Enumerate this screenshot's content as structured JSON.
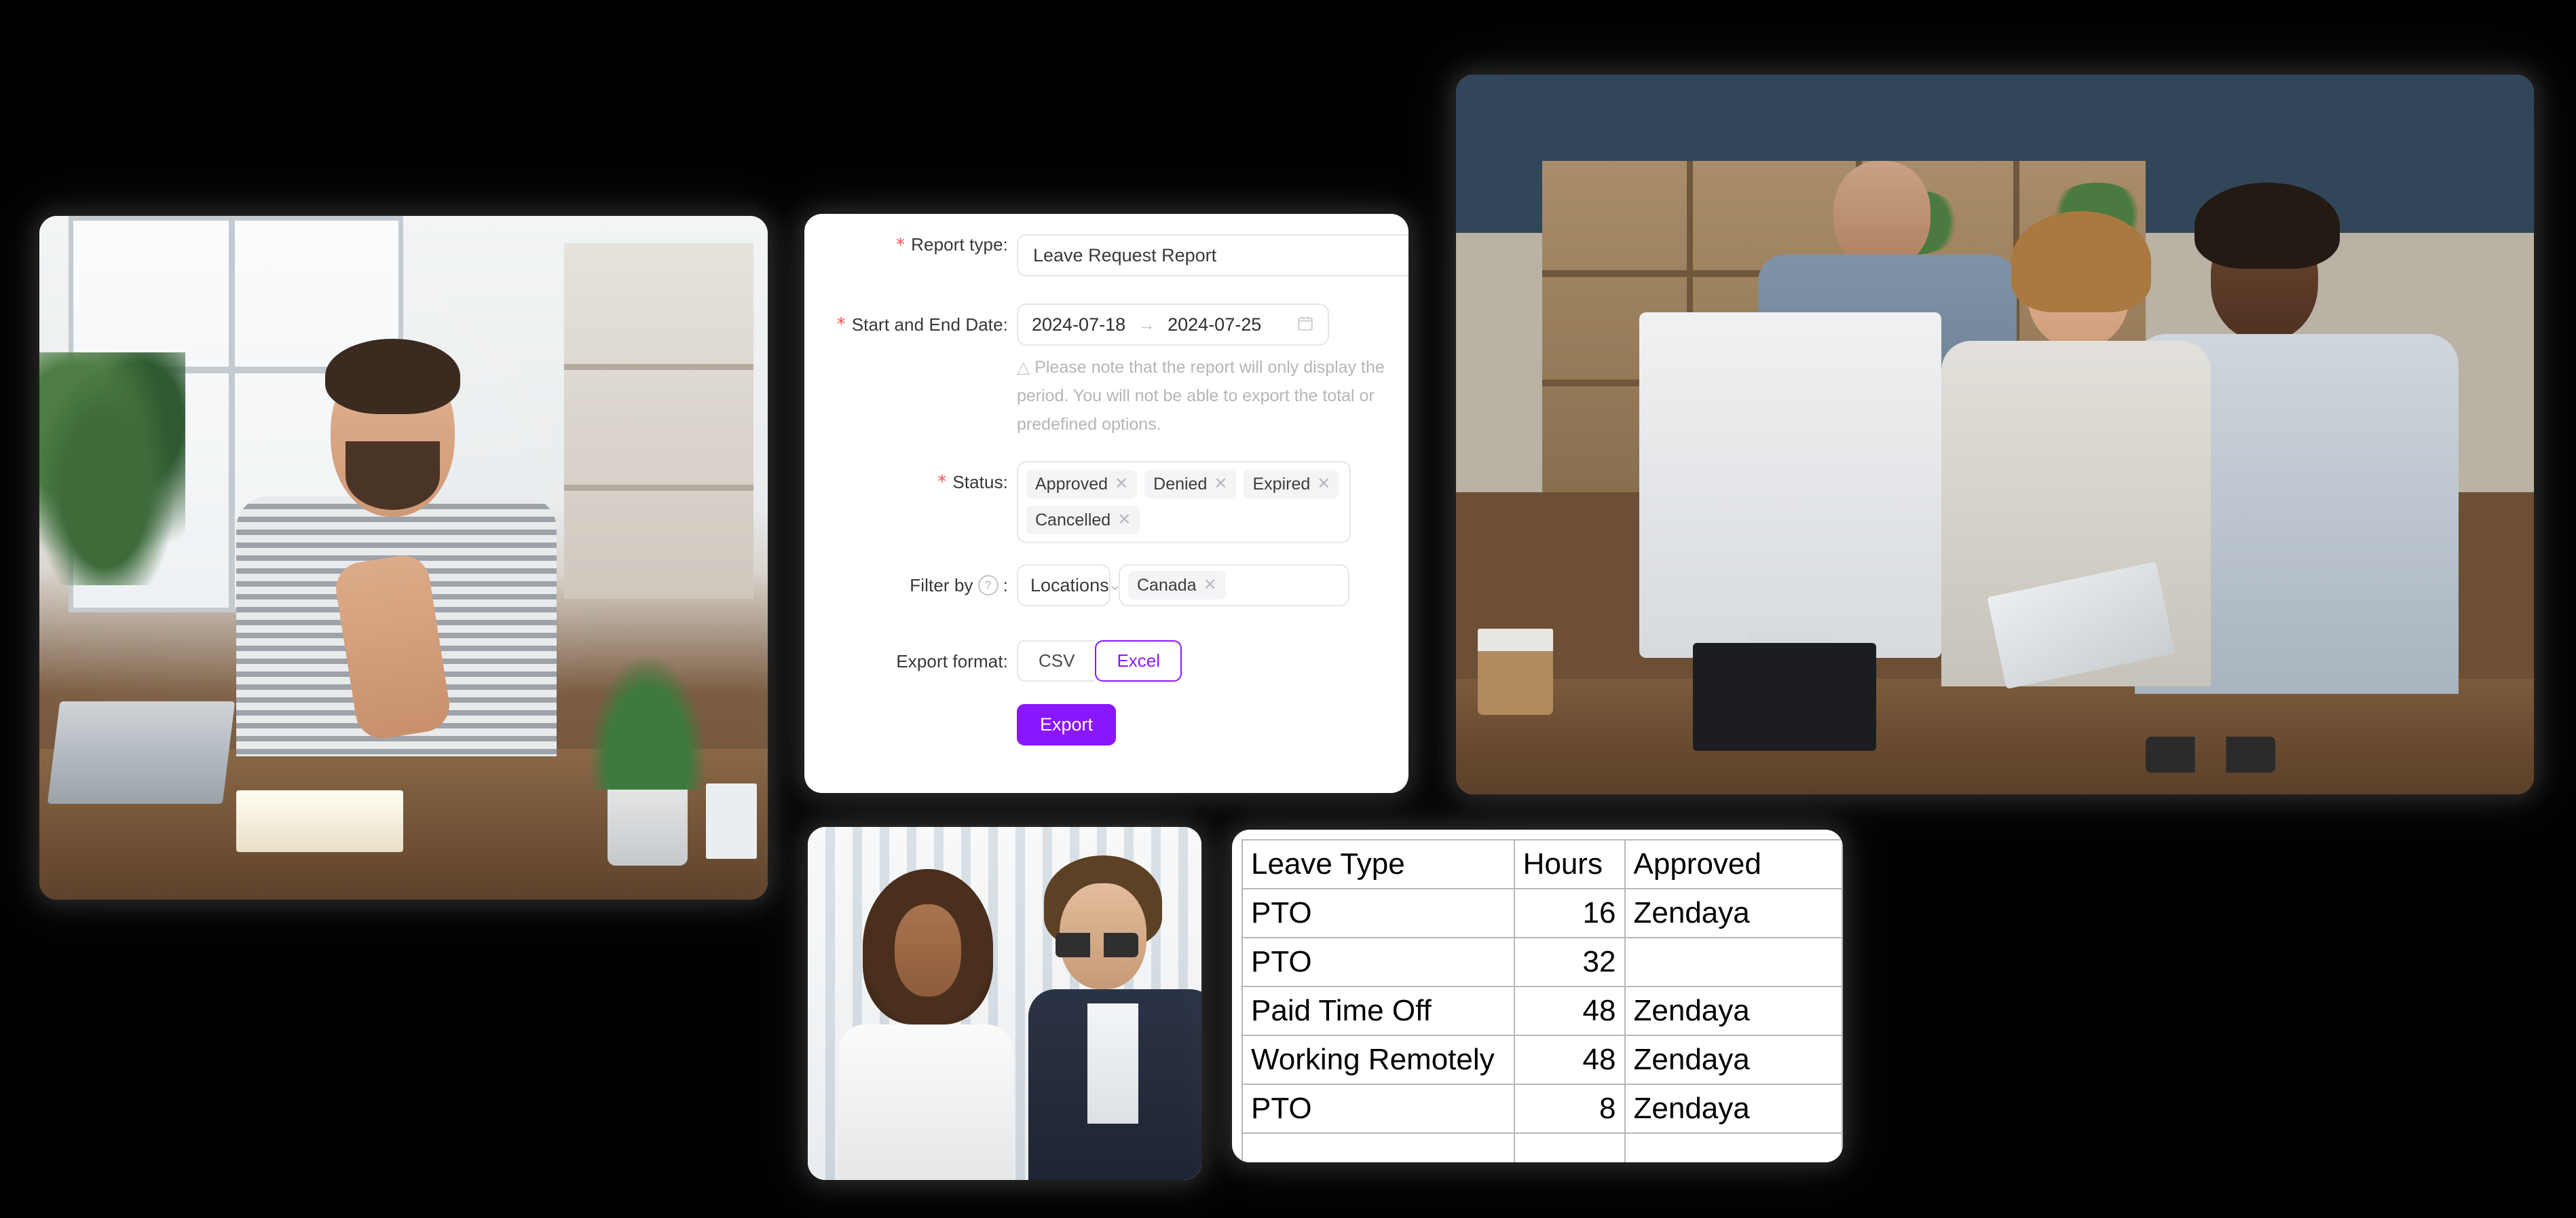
{
  "form": {
    "rows": {
      "report_type": {
        "label": "Report type:",
        "required": true,
        "value": "Leave Request Report"
      },
      "date_range": {
        "label": "Start and End Date:",
        "required": true,
        "start": "2024-07-18",
        "end": "2024-07-25",
        "separator_icon": "arrow-right-icon",
        "calendar_icon": "calendar-icon",
        "note_icon": "warning-triangle-icon",
        "note": "Please note that the report will only display the  period. You will not be able to export the total or  predefined options."
      },
      "status": {
        "label": "Status:",
        "required": true,
        "tags": [
          "Approved",
          "Denied",
          "Expired",
          "Cancelled"
        ],
        "remove_icon": "close-icon"
      },
      "filter_by": {
        "label": "Filter by",
        "label_suffix": ":",
        "help_icon": "question-circle-icon",
        "help_glyph": "?",
        "select_value": "Locations",
        "chevron_icon": "chevron-down-icon",
        "tags": [
          "Canada"
        ],
        "remove_icon": "close-icon"
      },
      "export_format": {
        "label": "Export format:",
        "options": [
          "CSV",
          "Excel"
        ],
        "selected": "Excel"
      }
    },
    "submit_label": "Export",
    "accent_color": "#8b17ff",
    "required_color": "#ff4d4f"
  },
  "table": {
    "columns": [
      "Leave Type",
      "Hours",
      "Approved"
    ],
    "rows": [
      {
        "leave_type": "PTO",
        "hours": "16",
        "approved": "Zendaya"
      },
      {
        "leave_type": "PTO",
        "hours": "32",
        "approved": ""
      },
      {
        "leave_type": "Paid Time Off",
        "hours": "48",
        "approved": "Zendaya"
      },
      {
        "leave_type": "Working Remotely",
        "hours": "48",
        "approved": "Zendaya"
      },
      {
        "leave_type": "PTO",
        "hours": "8",
        "approved": "Zendaya"
      },
      {
        "leave_type": "",
        "hours": "",
        "approved": ""
      }
    ]
  },
  "photos": {
    "left": "man-giving-thumbs-up-at-desk-photo",
    "top_right": "three-colleagues-looking-at-imac-photo",
    "bottom_center": "two-people-in-interview-photo"
  }
}
